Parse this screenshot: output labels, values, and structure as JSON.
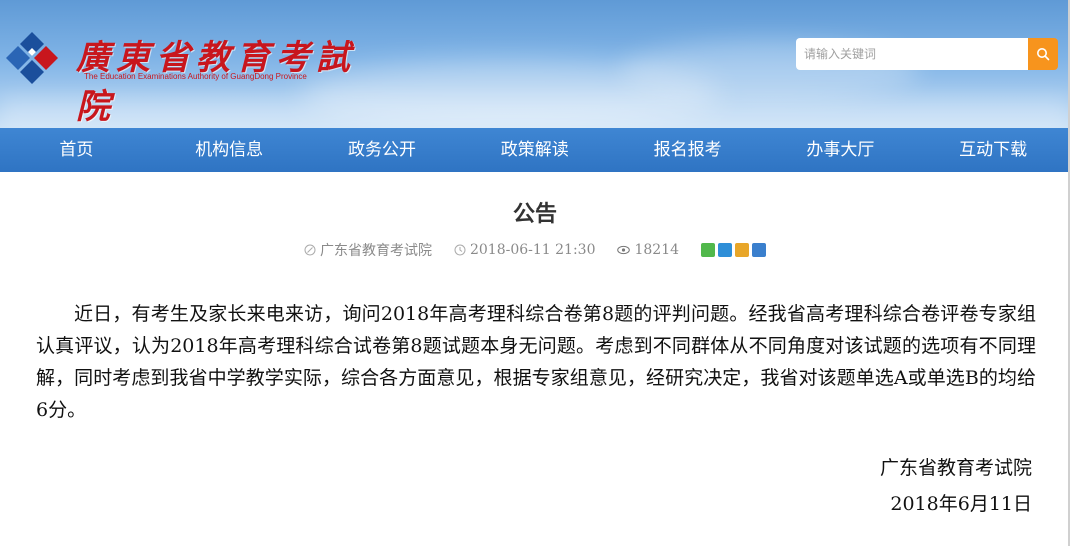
{
  "site": {
    "name_cn": "廣東省教育考試院",
    "name_en": "The Education Examinations Authority of GuangDong Province",
    "brand_red": "#c8161d",
    "nav_blue": "#3a7fcd",
    "search_orange": "#f7941d"
  },
  "search": {
    "placeholder": "请输入关键词",
    "button_icon": "search-icon"
  },
  "nav": {
    "items": [
      {
        "label": "首页"
      },
      {
        "label": "机构信息"
      },
      {
        "label": "政务公开"
      },
      {
        "label": "政策解读"
      },
      {
        "label": "报名报考"
      },
      {
        "label": "办事大厅"
      },
      {
        "label": "互动下载"
      }
    ]
  },
  "article": {
    "title": "公告",
    "source": "广东省教育考试院",
    "datetime": "2018-06-11 21:30",
    "views": "18214",
    "share_icons": [
      "wechat-icon",
      "qzone-icon",
      "weibo-icon",
      "more-share-icon"
    ],
    "body": "近日，有考生及家长来电来访，询问2018年高考理科综合卷第8题的评判问题。经我省高考理科综合卷评卷专家组认真评议，认为2018年高考理科综合试卷第8题试题本身无问题。考虑到不同群体从不同角度对该试题的选项有不同理解，同时考虑到我省中学教学实际，综合各方面意见，根据专家组意见，经研究决定，我省对该题单选A或单选B的均给6分。",
    "sign_org": "广东省教育考试院",
    "sign_date": "2018年6月11日"
  }
}
